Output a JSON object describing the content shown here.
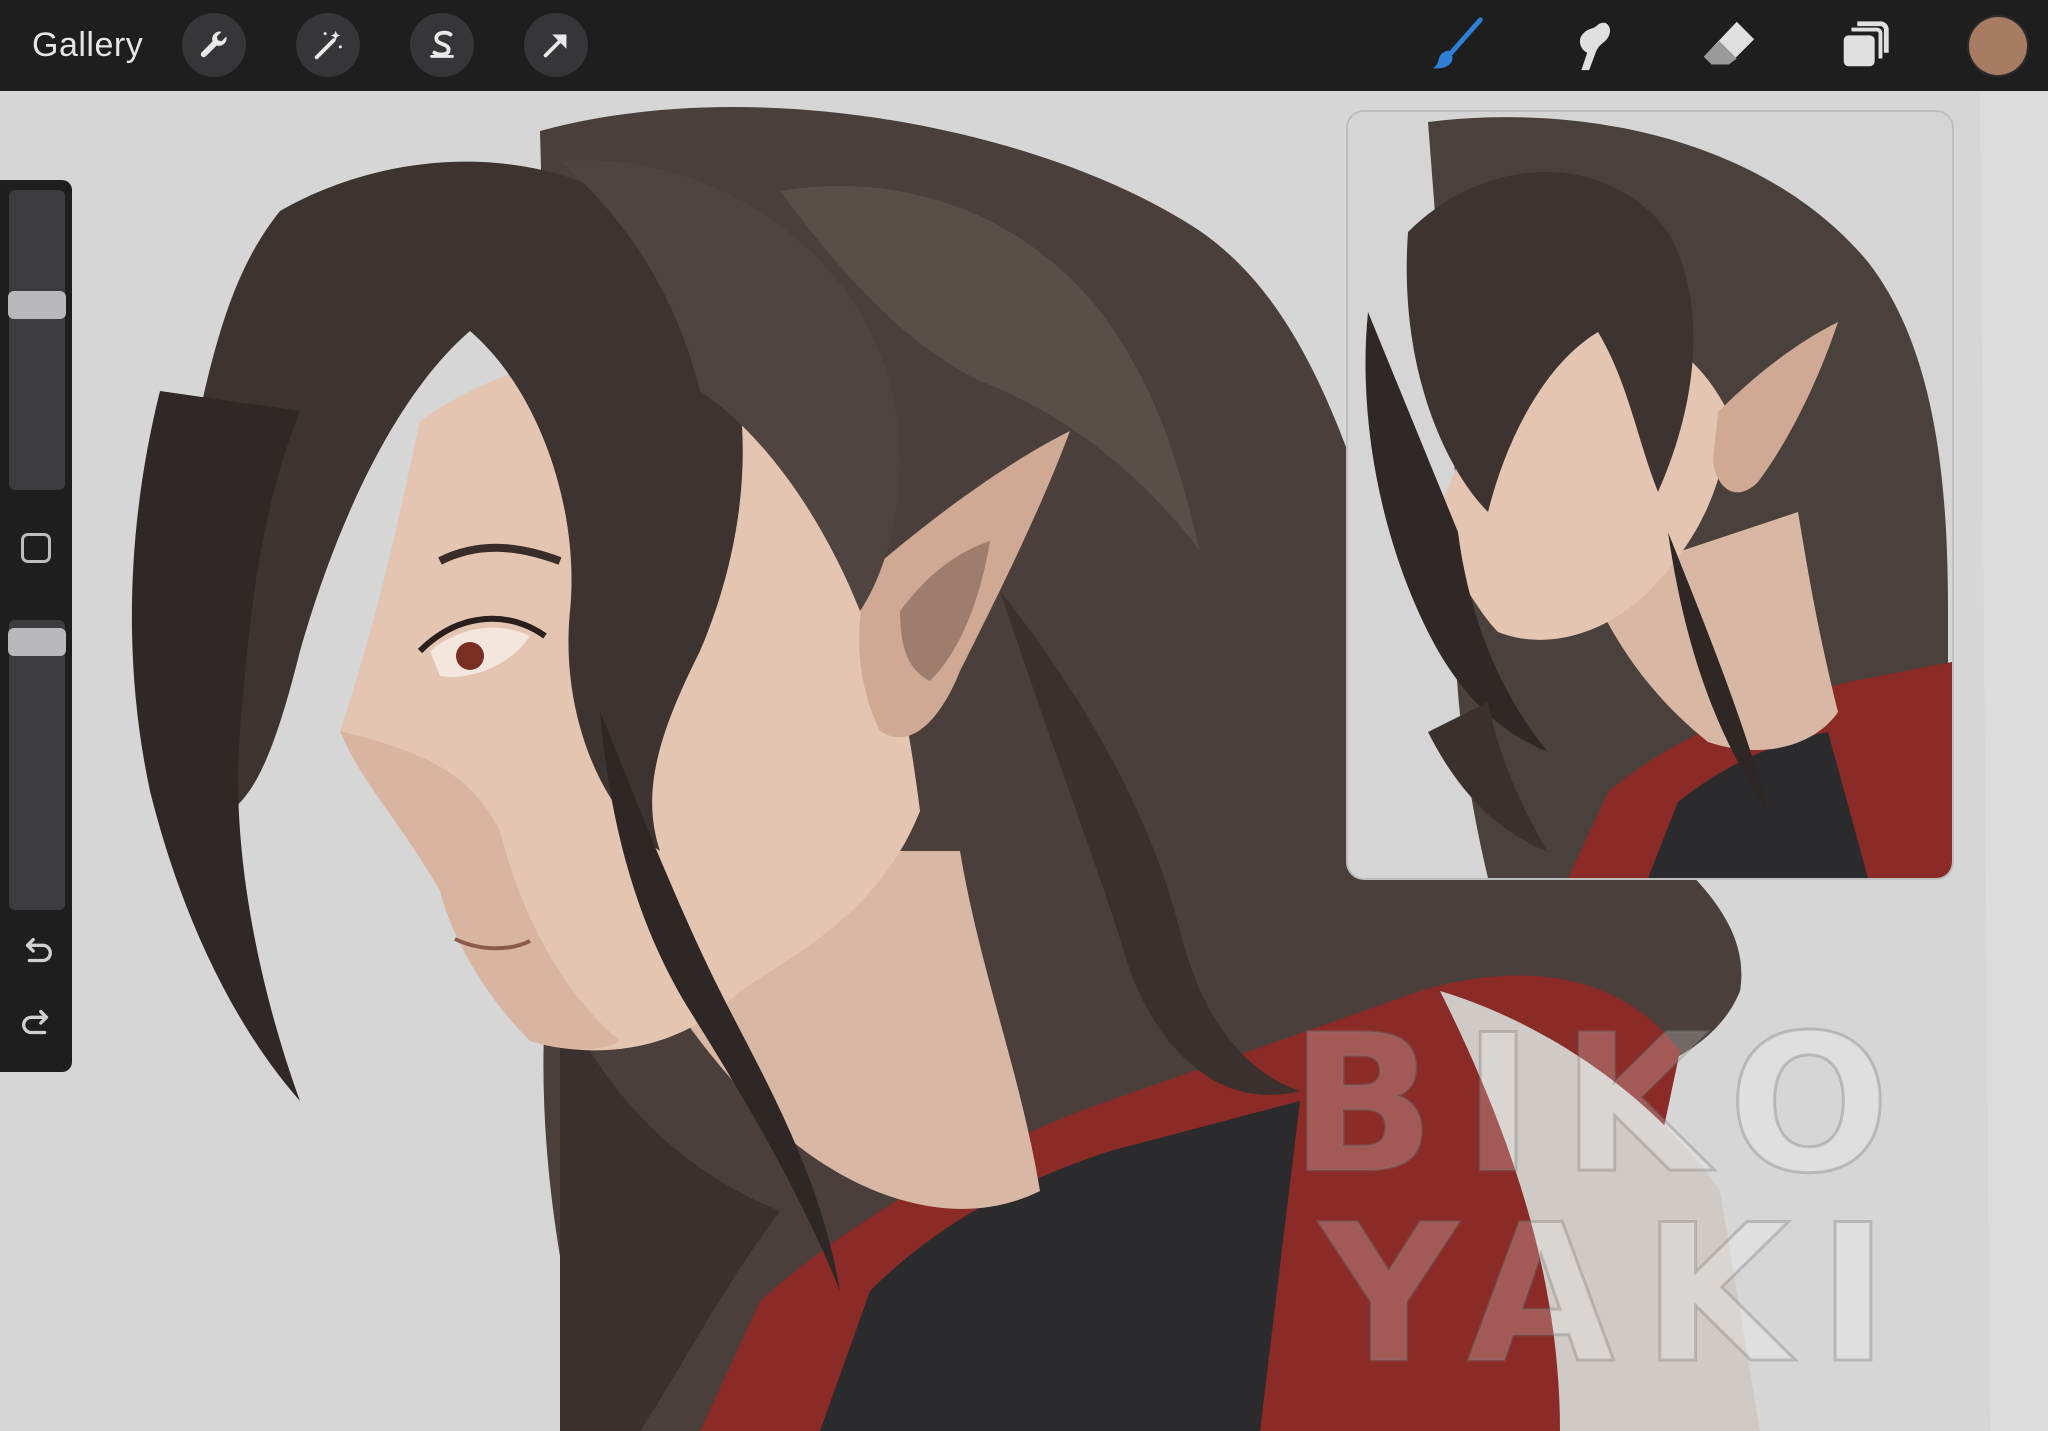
{
  "toolbar": {
    "gallery_label": "Gallery",
    "left_tools": [
      "wrench-icon",
      "magic-wand-icon",
      "selection-s-icon",
      "transform-arrow-icon"
    ],
    "right_tools": [
      "brush-icon",
      "smudge-icon",
      "eraser-icon",
      "layers-icon"
    ],
    "active_tool": "brush",
    "current_color": "#a87b63",
    "brush_accent": "#2f7fd6"
  },
  "sidebar": {
    "brush_size_level": 0.63,
    "opacity_level": 0.97,
    "icons": [
      "modify-square-icon",
      "undo-icon",
      "redo-icon"
    ]
  },
  "watermark": {
    "line1": "BIKO",
    "line2": "YAKI"
  },
  "reference_window": {
    "visible": true
  }
}
